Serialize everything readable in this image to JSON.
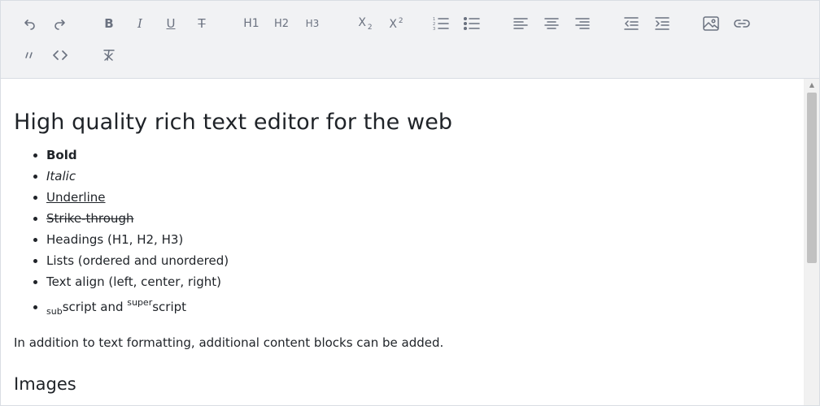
{
  "toolbar": {
    "bold_label": "B",
    "italic_label": "I",
    "underline_label": "U",
    "strike_label": "T",
    "h1_label": "H1",
    "h2_label": "H2",
    "h3_label": "H3",
    "subscript_label": "X",
    "subscript_mark": "2",
    "superscript_label": "X",
    "superscript_mark": "2",
    "icons": [
      "undo-icon",
      "redo-icon",
      "ordered-list-icon",
      "bullet-list-icon",
      "align-left-icon",
      "align-center-icon",
      "align-right-icon",
      "outdent-icon",
      "indent-icon",
      "image-icon",
      "link-icon",
      "blockquote-icon",
      "code-icon",
      "clear-format-icon"
    ]
  },
  "document": {
    "title": "High quality rich text editor for the web",
    "features": [
      "Bold",
      "Italic",
      "Underline",
      "Strike-through",
      "Headings (H1, H2, H3)",
      "Lists (ordered and unordered)",
      "Text align (left, center, right)"
    ],
    "subsup": {
      "sub": "sub",
      "middle": "script and ",
      "sup": "super",
      "tail": "script"
    },
    "paragraph": "In addition to text formatting, additional content blocks can be added.",
    "section_heading": "Images"
  }
}
